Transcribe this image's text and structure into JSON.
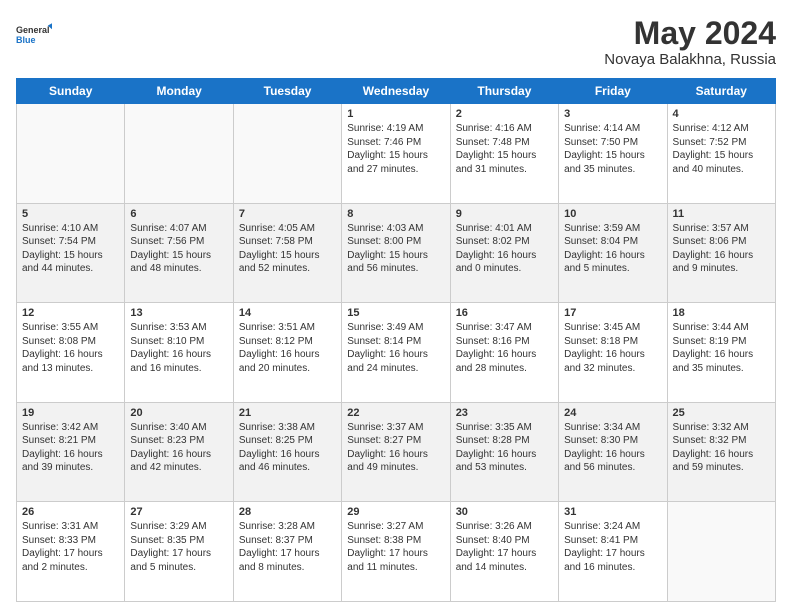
{
  "logo": {
    "general": "General",
    "blue": "Blue"
  },
  "title": {
    "month_year": "May 2024",
    "location": "Novaya Balakhna, Russia"
  },
  "days_of_week": [
    "Sunday",
    "Monday",
    "Tuesday",
    "Wednesday",
    "Thursday",
    "Friday",
    "Saturday"
  ],
  "weeks": [
    [
      {
        "day": "",
        "info": ""
      },
      {
        "day": "",
        "info": ""
      },
      {
        "day": "",
        "info": ""
      },
      {
        "day": "1",
        "info": "Sunrise: 4:19 AM\nSunset: 7:46 PM\nDaylight: 15 hours\nand 27 minutes."
      },
      {
        "day": "2",
        "info": "Sunrise: 4:16 AM\nSunset: 7:48 PM\nDaylight: 15 hours\nand 31 minutes."
      },
      {
        "day": "3",
        "info": "Sunrise: 4:14 AM\nSunset: 7:50 PM\nDaylight: 15 hours\nand 35 minutes."
      },
      {
        "day": "4",
        "info": "Sunrise: 4:12 AM\nSunset: 7:52 PM\nDaylight: 15 hours\nand 40 minutes."
      }
    ],
    [
      {
        "day": "5",
        "info": "Sunrise: 4:10 AM\nSunset: 7:54 PM\nDaylight: 15 hours\nand 44 minutes."
      },
      {
        "day": "6",
        "info": "Sunrise: 4:07 AM\nSunset: 7:56 PM\nDaylight: 15 hours\nand 48 minutes."
      },
      {
        "day": "7",
        "info": "Sunrise: 4:05 AM\nSunset: 7:58 PM\nDaylight: 15 hours\nand 52 minutes."
      },
      {
        "day": "8",
        "info": "Sunrise: 4:03 AM\nSunset: 8:00 PM\nDaylight: 15 hours\nand 56 minutes."
      },
      {
        "day": "9",
        "info": "Sunrise: 4:01 AM\nSunset: 8:02 PM\nDaylight: 16 hours\nand 0 minutes."
      },
      {
        "day": "10",
        "info": "Sunrise: 3:59 AM\nSunset: 8:04 PM\nDaylight: 16 hours\nand 5 minutes."
      },
      {
        "day": "11",
        "info": "Sunrise: 3:57 AM\nSunset: 8:06 PM\nDaylight: 16 hours\nand 9 minutes."
      }
    ],
    [
      {
        "day": "12",
        "info": "Sunrise: 3:55 AM\nSunset: 8:08 PM\nDaylight: 16 hours\nand 13 minutes."
      },
      {
        "day": "13",
        "info": "Sunrise: 3:53 AM\nSunset: 8:10 PM\nDaylight: 16 hours\nand 16 minutes."
      },
      {
        "day": "14",
        "info": "Sunrise: 3:51 AM\nSunset: 8:12 PM\nDaylight: 16 hours\nand 20 minutes."
      },
      {
        "day": "15",
        "info": "Sunrise: 3:49 AM\nSunset: 8:14 PM\nDaylight: 16 hours\nand 24 minutes."
      },
      {
        "day": "16",
        "info": "Sunrise: 3:47 AM\nSunset: 8:16 PM\nDaylight: 16 hours\nand 28 minutes."
      },
      {
        "day": "17",
        "info": "Sunrise: 3:45 AM\nSunset: 8:18 PM\nDaylight: 16 hours\nand 32 minutes."
      },
      {
        "day": "18",
        "info": "Sunrise: 3:44 AM\nSunset: 8:19 PM\nDaylight: 16 hours\nand 35 minutes."
      }
    ],
    [
      {
        "day": "19",
        "info": "Sunrise: 3:42 AM\nSunset: 8:21 PM\nDaylight: 16 hours\nand 39 minutes."
      },
      {
        "day": "20",
        "info": "Sunrise: 3:40 AM\nSunset: 8:23 PM\nDaylight: 16 hours\nand 42 minutes."
      },
      {
        "day": "21",
        "info": "Sunrise: 3:38 AM\nSunset: 8:25 PM\nDaylight: 16 hours\nand 46 minutes."
      },
      {
        "day": "22",
        "info": "Sunrise: 3:37 AM\nSunset: 8:27 PM\nDaylight: 16 hours\nand 49 minutes."
      },
      {
        "day": "23",
        "info": "Sunrise: 3:35 AM\nSunset: 8:28 PM\nDaylight: 16 hours\nand 53 minutes."
      },
      {
        "day": "24",
        "info": "Sunrise: 3:34 AM\nSunset: 8:30 PM\nDaylight: 16 hours\nand 56 minutes."
      },
      {
        "day": "25",
        "info": "Sunrise: 3:32 AM\nSunset: 8:32 PM\nDaylight: 16 hours\nand 59 minutes."
      }
    ],
    [
      {
        "day": "26",
        "info": "Sunrise: 3:31 AM\nSunset: 8:33 PM\nDaylight: 17 hours\nand 2 minutes."
      },
      {
        "day": "27",
        "info": "Sunrise: 3:29 AM\nSunset: 8:35 PM\nDaylight: 17 hours\nand 5 minutes."
      },
      {
        "day": "28",
        "info": "Sunrise: 3:28 AM\nSunset: 8:37 PM\nDaylight: 17 hours\nand 8 minutes."
      },
      {
        "day": "29",
        "info": "Sunrise: 3:27 AM\nSunset: 8:38 PM\nDaylight: 17 hours\nand 11 minutes."
      },
      {
        "day": "30",
        "info": "Sunrise: 3:26 AM\nSunset: 8:40 PM\nDaylight: 17 hours\nand 14 minutes."
      },
      {
        "day": "31",
        "info": "Sunrise: 3:24 AM\nSunset: 8:41 PM\nDaylight: 17 hours\nand 16 minutes."
      },
      {
        "day": "",
        "info": ""
      }
    ]
  ]
}
